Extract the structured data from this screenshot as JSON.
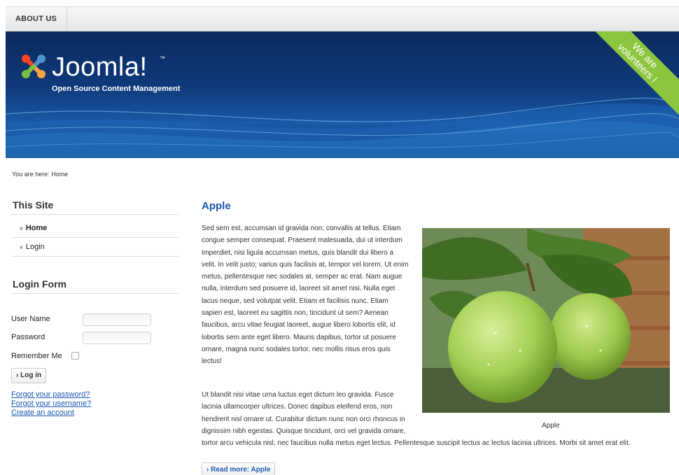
{
  "nav": {
    "about_label": "ABOUT US"
  },
  "header": {
    "logo_word": "Joomla!",
    "tm": "™",
    "tagline": "Open Source Content Management",
    "ribbon_line1": "We are",
    "ribbon_line2": "volunteers !"
  },
  "breadcrumb": "You are here: Home",
  "sidebar": {
    "site_title": "This Site",
    "menu": [
      {
        "label": "Home"
      },
      {
        "label": "Login"
      }
    ],
    "login_title": "Login Form",
    "username_label": "User Name",
    "password_label": "Password",
    "remember_label": "Remember Me",
    "login_button": "Log in",
    "bullet": "■",
    "button_arrow": "›",
    "links": {
      "forgot_password": "Forgot your password?",
      "forgot_username": "Forgot your username?",
      "create_account": "Create an account"
    }
  },
  "article": {
    "title": "Apple",
    "para1_lines": [
      "Sed sem est, accumsan id gravida non; convallis at tellus. Etiam",
      "congue semper consequat. Praesent malesuada, dui ut interdum",
      "imperdiet, nisi ligula accumsan metus, quis blandit dui libero a",
      "velit. In velit justo; varius quis facilisis at, tempor vel lorem. Ut enim",
      "metus, pellentesque nec sodales at, semper ac erat. Nam augue",
      "nulla, interdum sed posuere id, laoreet sit amet nisi. Nulla eget",
      "lacus neque, sed volutpat velit. Etiam et facilisis nunc. Etiam",
      "sapien est, laoreet eu sagittis non, tincidunt ut sem? Aenean",
      "faucibus, arcu vitae feugiat laoreet, augue libero lobortis elit, id",
      "lobortis sem ante eget libero. Mauris dapibus, tortor ut posuere",
      "ornare, magna nunc sodales tortor, nec mollis risus eros quis",
      "lectus!"
    ],
    "para2_lines": [
      "Ut blandit nisi vitae urna luctus eget dictum leo gravida. Fusce",
      "lacinia ullamcorper ultrices. Donec dapibus eleifend eros, non",
      "hendrerit nisl ornare ut. Curabitur dictum nunc non orci rhoncus in",
      "dignissim nibh egestas. Quisque tincidunt, orci vel gravida ornare,",
      "tortor arcu vehicula nisl, nec faucibus nulla metus eget lectus. Pellentesque suscipit lectus ac lectus lacinia ultrices. Morbi sit amet erat elit."
    ],
    "image_caption": "Apple",
    "read_more": "Read more: Apple"
  },
  "colors": {
    "link": "#1b57b1",
    "ribbon": "#8cc63f",
    "banner": "#0f3a7c"
  }
}
